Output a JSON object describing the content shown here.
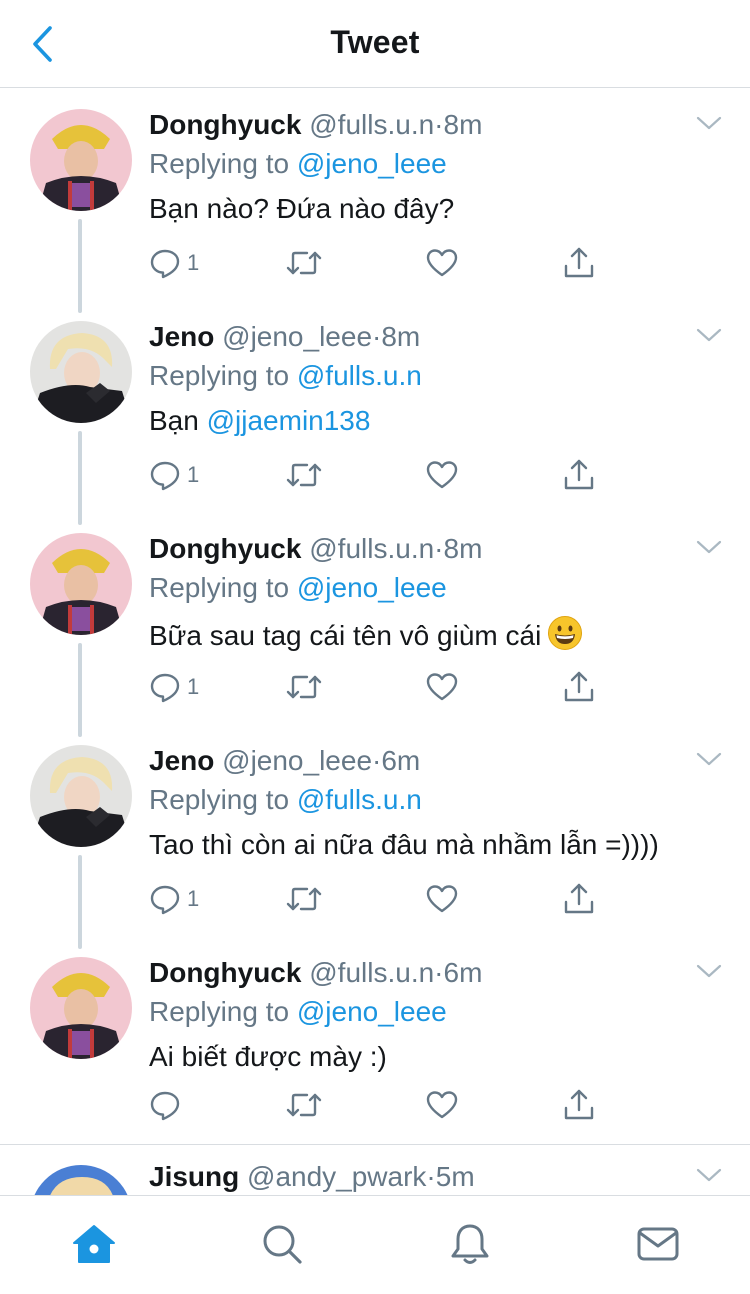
{
  "header": {
    "title": "Tweet"
  },
  "colors": {
    "accent": "#1b95e0",
    "muted": "#657786",
    "text": "#14171a",
    "border": "#d9dde1"
  },
  "tweets": [
    {
      "name": "Donghyuck",
      "handle": "@fulls.u.n",
      "time": "8m",
      "replying_prefix": "Replying to ",
      "replying_to": "@jeno_leee",
      "text": "Bạn nào? Đứa nào đây?",
      "reply_count": "1"
    },
    {
      "name": "Jeno",
      "handle": "@jeno_leee",
      "time": "8m",
      "replying_prefix": "Replying to ",
      "replying_to": "@fulls.u.n",
      "text_prefix": "Bạn ",
      "text_mention": "@jjaemin138",
      "reply_count": "1"
    },
    {
      "name": "Donghyuck",
      "handle": "@fulls.u.n",
      "time": "8m",
      "replying_prefix": "Replying to ",
      "replying_to": "@jeno_leee",
      "text": "Bữa sau tag cái tên vô giùm cái",
      "emoji": "grinning-face",
      "reply_count": "1"
    },
    {
      "name": "Jeno",
      "handle": "@jeno_leee",
      "time": "6m",
      "replying_prefix": "Replying to ",
      "replying_to": "@fulls.u.n",
      "text": "Tao thì còn ai nữa đâu mà nhầm lẫn =))))",
      "reply_count": "1"
    },
    {
      "name": "Donghyuck",
      "handle": "@fulls.u.n",
      "time": "6m",
      "replying_prefix": "Replying to ",
      "replying_to": "@jeno_leee",
      "text": "Ai biết được mày :)",
      "reply_count": ""
    }
  ],
  "partial_tweet": {
    "name": "Jisung",
    "handle": "@andy_pwark",
    "time": "5m"
  },
  "tabbar": {
    "active": "home",
    "icons": [
      "home-icon",
      "search-icon",
      "bell-icon",
      "mail-icon"
    ]
  }
}
